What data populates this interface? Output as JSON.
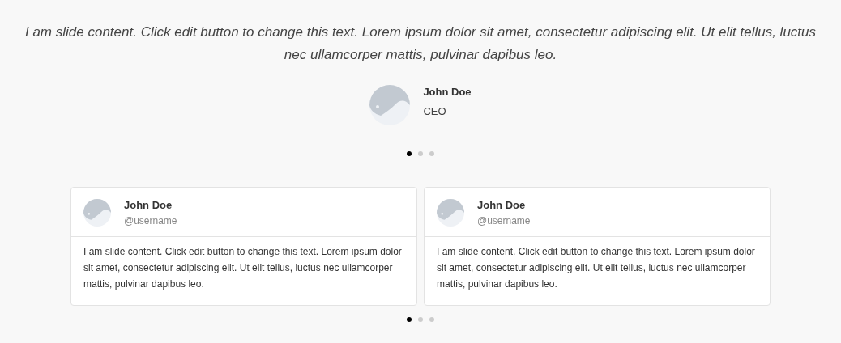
{
  "testimonial": {
    "quote": "I am slide content. Click edit button to change this text. Lorem ipsum dolor sit amet, consectetur adipiscing elit. Ut elit tellus, luctus nec ullamcorper mattis, pulvinar dapibus leo.",
    "name": "John Doe",
    "title": "CEO"
  },
  "testimonial_dots": [
    {
      "selected": true
    },
    {
      "selected": false
    },
    {
      "selected": false
    }
  ],
  "cards": [
    {
      "name": "John Doe",
      "handle": "@username",
      "text": "I am slide content. Click edit button to change this text. Lorem ipsum dolor sit amet, consectetur adipiscing elit. Ut elit tellus, luctus nec ullamcorper mattis, pulvinar dapibus leo."
    },
    {
      "name": "John Doe",
      "handle": "@username",
      "text": "I am slide content. Click edit button to change this text. Lorem ipsum dolor sit amet, consectetur adipiscing elit. Ut elit tellus, luctus nec ullamcorper mattis, pulvinar dapibus leo."
    }
  ],
  "card_dots": [
    {
      "selected": true
    },
    {
      "selected": false
    },
    {
      "selected": false
    }
  ]
}
